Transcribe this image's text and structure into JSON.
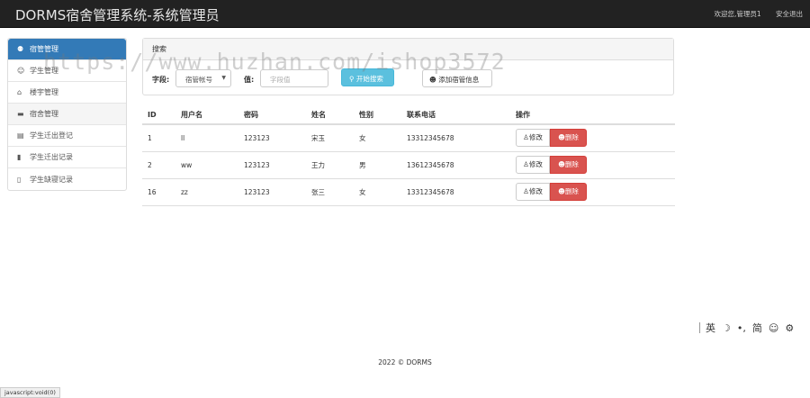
{
  "navbar": {
    "brand": "DORMS宿舍管理系统-系统管理员",
    "welcome": "欢迎您,管理员1",
    "logout": "安全退出"
  },
  "sidebar": {
    "items": [
      {
        "icon": "user-circle-icon",
        "glyph": "⚉",
        "label": "宿管管理"
      },
      {
        "icon": "user-icon",
        "glyph": "☺",
        "label": "学生管理"
      },
      {
        "icon": "home-icon",
        "glyph": "⌂",
        "label": "楼宇管理"
      },
      {
        "icon": "bed-icon",
        "glyph": "▬",
        "label": "宿舍管理"
      },
      {
        "icon": "card-icon",
        "glyph": "▤",
        "label": "学生迁出登记"
      },
      {
        "icon": "bookmark-icon",
        "glyph": "▮",
        "label": "学生迁出记录"
      },
      {
        "icon": "bookmark-outline-icon",
        "glyph": "▯",
        "label": "学生缺寝记录"
      }
    ]
  },
  "search": {
    "panel_title": "搜索",
    "field_label": "字段:",
    "field_value": "宿管帐号",
    "value_label": "值:",
    "value_placeholder": "字段值",
    "search_button": "开始搜索",
    "add_button": "添加宿管信息"
  },
  "table": {
    "headers": [
      "ID",
      "用户名",
      "密码",
      "姓名",
      "性别",
      "联系电话",
      "操作"
    ],
    "rows": [
      {
        "id": "1",
        "username": "ll",
        "password": "123123",
        "name": "宋玉",
        "gender": "女",
        "phone": "13312345678"
      },
      {
        "id": "2",
        "username": "ww",
        "password": "123123",
        "name": "王力",
        "gender": "男",
        "phone": "13612345678"
      },
      {
        "id": "16",
        "username": "zz",
        "password": "123123",
        "name": "张三",
        "gender": "女",
        "phone": "13312345678"
      }
    ],
    "edit_label": "修改",
    "delete_label": "删除"
  },
  "footer": {
    "copyright": "2022 © DORMS"
  },
  "statusbar": {
    "text": "javascript:void(0)"
  },
  "ime": {
    "lang": "英",
    "moon": "☽",
    "punct": "•,",
    "simp": "简",
    "emoji": "☺",
    "gear": "⚙"
  },
  "watermark": "https://www.huzhan.com/ishop3572",
  "colors": {
    "primary": "#337ab7",
    "info": "#5bc0de",
    "danger": "#d9534f",
    "navbar": "#222222"
  }
}
